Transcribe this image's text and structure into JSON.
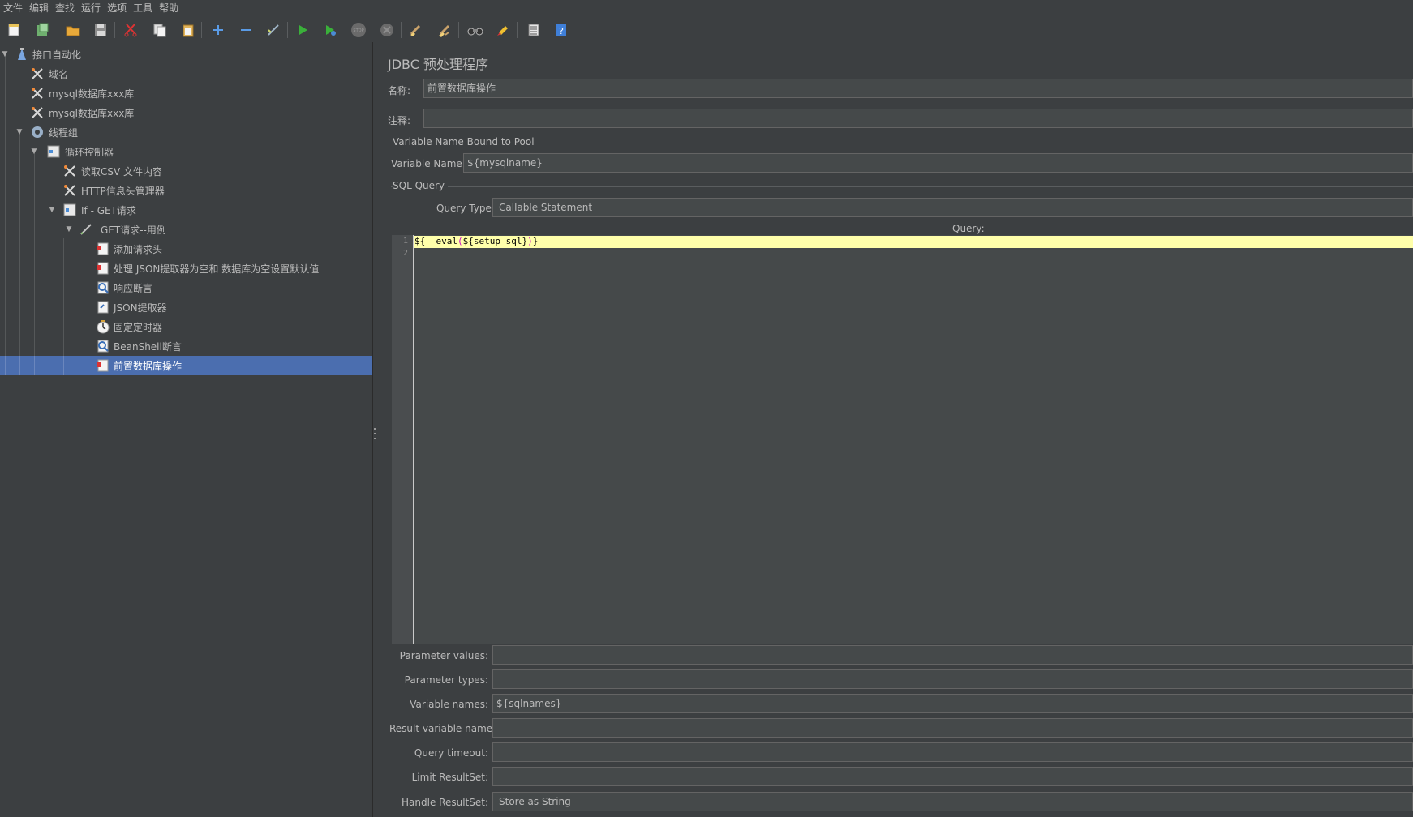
{
  "menu": [
    "文件",
    "编辑",
    "查找",
    "运行",
    "选项",
    "工具",
    "帮助"
  ],
  "toolbar": {
    "icons": [
      "new-icon",
      "templates-icon",
      "open-icon",
      "save-icon",
      "cut-icon",
      "copy-icon",
      "paste-icon",
      "expand-icon",
      "collapse-icon",
      "toggle-icon",
      "start-icon",
      "start-no-pause-icon",
      "stop-icon",
      "shutdown-icon",
      "clear-icon",
      "clear-all-icon",
      "search-icon",
      "reset-search-icon",
      "function-helper-icon",
      "help-icon"
    ]
  },
  "tree": [
    {
      "label": "接口自动化",
      "icon": "test-plan-icon",
      "expanded": true
    },
    {
      "label": "域名",
      "icon": "config-element-icon"
    },
    {
      "label": "mysql数据库xxx库",
      "icon": "config-element-icon"
    },
    {
      "label": "mysql数据库xxx库",
      "icon": "config-element-icon"
    },
    {
      "label": "线程组",
      "icon": "thread-group-icon",
      "expanded": true
    },
    {
      "label": "循环控制器",
      "icon": "loop-controller-icon",
      "expanded": true
    },
    {
      "label": "读取CSV 文件内容",
      "icon": "config-element-icon"
    },
    {
      "label": "HTTP信息头管理器",
      "icon": "config-element-icon"
    },
    {
      "label": "If - GET请求",
      "icon": "if-controller-icon",
      "expanded": true
    },
    {
      "label": "GET请求--用例",
      "icon": "sampler-icon",
      "expanded": true
    },
    {
      "label": "添加请求头",
      "icon": "preprocessor-icon"
    },
    {
      "label": "处理 JSON提取器为空和 数据库为空设置默认值",
      "icon": "preprocessor-icon"
    },
    {
      "label": "响应断言",
      "icon": "assertion-icon"
    },
    {
      "label": "JSON提取器",
      "icon": "extractor-icon"
    },
    {
      "label": "固定定时器",
      "icon": "timer-icon"
    },
    {
      "label": "BeanShell断言",
      "icon": "assertion-icon"
    },
    {
      "label": "前置数据库操作",
      "icon": "preprocessor-icon",
      "selected": true
    }
  ],
  "panel": {
    "title": "JDBC 预处理程序",
    "name_label": "名称:",
    "name_value": "前置数据库操作",
    "comment_label": "注释:",
    "comment_value": "",
    "pool_group": "Variable Name Bound to Pool",
    "variable_name_label": "Variable Name:",
    "variable_name_value": "${mysqlname}",
    "sql_group": "SQL Query",
    "query_type_label": "Query Type:",
    "query_type_value": "Callable Statement",
    "query_label": "Query:",
    "code_lines": [
      "1",
      "2"
    ],
    "code": {
      "p1": "${",
      "fn": "__eval",
      "p2": "(",
      "arg": "${setup_sql}",
      "p3": ")",
      "p4": "}"
    },
    "param_values_label": "Parameter values:",
    "param_values_value": "",
    "param_types_label": "Parameter types:",
    "param_types_value": "",
    "variable_names_label": "Variable names:",
    "variable_names_value": "${sqlnames}",
    "result_var_label": "Result variable name:",
    "result_var_value": "",
    "query_timeout_label": "Query timeout:",
    "query_timeout_value": "",
    "limit_resultset_label": "Limit ResultSet:",
    "limit_resultset_value": "",
    "handle_resultset_label": "Handle ResultSet:",
    "handle_resultset_value": "Store as String"
  }
}
